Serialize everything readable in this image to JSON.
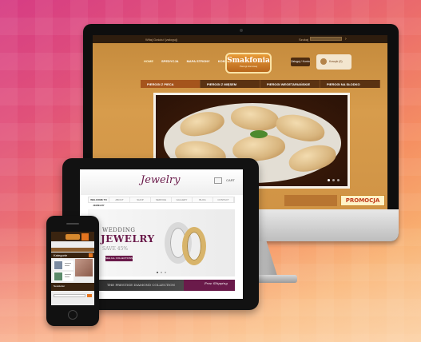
{
  "monitor_site": {
    "topbar_text": "Witaj Gościu! (zaloguj)",
    "search_label": "Szukaj",
    "nav": [
      "HOME",
      "SPEDYCJA",
      "MAPA STRONY",
      "KONTAKT"
    ],
    "logo_name": "Smakfonia",
    "logo_tagline": "Pierogi domowej",
    "login_label": "Zaloguj / Konto",
    "cart_label": "Koszyk (0)",
    "categories": [
      "PIEROGI Z PIECA",
      "PIEROGI Z MIĘSEM",
      "PIEROGI WEGETARIAŃSKIE",
      "PIEROGI NA SŁODKO"
    ],
    "promo_text": "PROMOCJA"
  },
  "tablet_site": {
    "logo": "Jewelry",
    "cart": "CART",
    "nav": [
      "WELCOME TO JEWELRY",
      "ABOUT",
      "SHOP",
      "SERVICE",
      "GALLERY",
      "BLOG",
      "CONTACT"
    ],
    "hero_line1": "WEDDING",
    "hero_line2": "JEWELRY",
    "hero_save": "SAVE 45%",
    "hero_button": "SEE ALL COLLECTIONS",
    "banner_left": "THE PRESTIGE DIAMOND COLLECTION",
    "banner_right": "Free Shipping"
  },
  "phone_site": {
    "section_label": "Kategorie",
    "bottom_label": "Newsletter"
  },
  "colors": {
    "bg_top": "#d63c84",
    "bg_bottom": "#f9c490",
    "monitor_site_brown": "#5a3212",
    "jewelry_plum": "#6a1a4a",
    "accent_orange": "#e4741e"
  }
}
